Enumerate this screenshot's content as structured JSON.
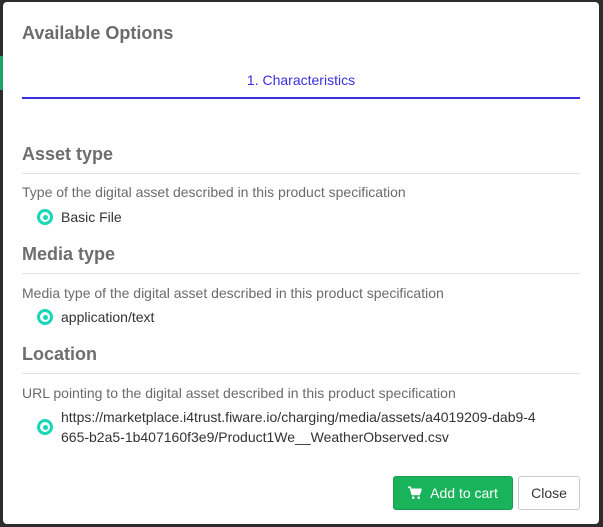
{
  "modal": {
    "title": "Available Options"
  },
  "tabs": [
    {
      "label": "1. Characteristics",
      "active": true
    }
  ],
  "sections": [
    {
      "heading": "Asset type",
      "description": "Type of the digital asset described in this product specification",
      "option": "Basic File"
    },
    {
      "heading": "Media type",
      "description": "Media type of the digital asset described in this product specification",
      "option": "application/text"
    },
    {
      "heading": "Location",
      "description": "URL pointing to the digital asset described in this product specification",
      "option": "https://marketplace.i4trust.fiware.io/charging/media/assets/a4019209-dab9-4665-b2a5-1b407160f3e9/Product1We__WeatherObserved.csv"
    }
  ],
  "buttons": {
    "add_to_cart": "Add to cart",
    "close": "Close"
  },
  "icons": {
    "cart": "shopping-cart-icon",
    "radio": "radio-selected-icon"
  },
  "colors": {
    "tab_active": "#3b2ee0",
    "radio": "#19d6b6",
    "primary_button": "#18b35a"
  }
}
